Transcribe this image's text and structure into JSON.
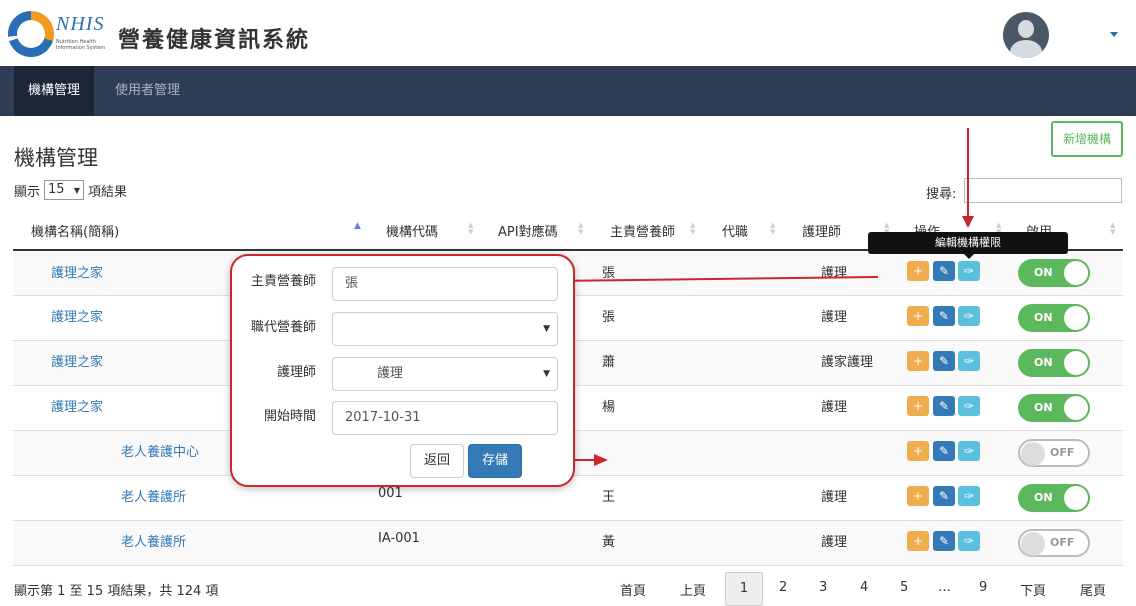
{
  "app": {
    "logo_text": "NHIS",
    "logo_sub": "Nutrition Health Information System",
    "title": "營養健康資訊系統"
  },
  "nav": {
    "tabs": [
      {
        "label": "機構管理",
        "active": true
      },
      {
        "label": "使用者管理",
        "active": false
      }
    ]
  },
  "page": {
    "title": "機構管理",
    "add_button": "新增機構",
    "length_prefix": "顯示",
    "length_value": "15",
    "length_suffix": "項結果",
    "search_label": "搜尋:"
  },
  "table": {
    "columns": [
      "機構名稱(簡稱)",
      "機構代碼",
      "API對應碼",
      "主責營養師",
      "代職",
      "護理師",
      "操作",
      "啟用"
    ],
    "rows": [
      {
        "name": "護理之家",
        "code": "",
        "dietitian": "張",
        "nurse": "護理",
        "enabled": "ON"
      },
      {
        "name": "護理之家",
        "code": "",
        "dietitian": "張",
        "nurse": "護理",
        "enabled": "ON"
      },
      {
        "name": "護理之家",
        "code": "",
        "dietitian": "蕭",
        "nurse": "護家護理",
        "enabled": "ON"
      },
      {
        "name": "護理之家",
        "code": "",
        "dietitian": "楊",
        "nurse": "護理",
        "enabled": "ON"
      },
      {
        "name": "老人養護中心",
        "code": "",
        "dietitian": "",
        "nurse": "",
        "enabled": "OFF"
      },
      {
        "name": "老人養護所",
        "code": "001",
        "dietitian": "王",
        "nurse": "護理",
        "enabled": "ON"
      },
      {
        "name": "老人養護所",
        "code": "IA-001",
        "dietitian": "黃",
        "nurse": "護理",
        "enabled": "OFF"
      }
    ],
    "tooltip": "編輯機構權限"
  },
  "popup": {
    "dietitian_label": "主責營養師",
    "dietitian_value": "張",
    "substitute_label": "職代營養師",
    "substitute_value": "",
    "nurse_label": "護理師",
    "nurse_value": "護理",
    "start_label": "開始時間",
    "start_value": "2017-10-31",
    "back_button": "返回",
    "save_button": "存儲"
  },
  "footer": {
    "info": "顯示第 1 至 15 項結果，共 124 項",
    "pages": {
      "first": "首頁",
      "prev": "上頁",
      "p1": "1",
      "p2": "2",
      "p3": "3",
      "p4": "4",
      "p5": "5",
      "ellipsis": "…",
      "p9": "9",
      "next": "下頁",
      "last": "尾頁"
    }
  },
  "colors": {
    "nav_bg": "#2f3e55",
    "accent_blue": "#337ab7",
    "success_green": "#5cb85c",
    "annotation_red": "#c9272c"
  }
}
